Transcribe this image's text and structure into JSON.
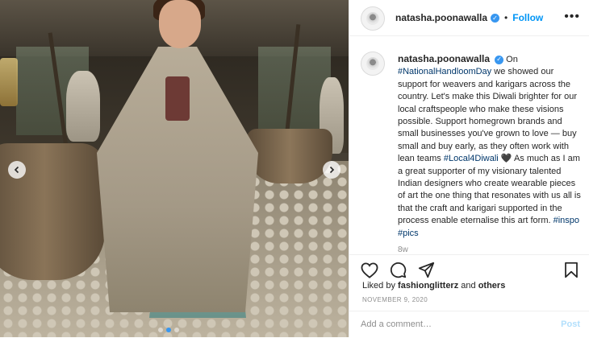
{
  "post": {
    "username": "natasha.poonawalla",
    "follow_label": "Follow",
    "more_label": "•••",
    "caption_username": "natasha.poonawalla",
    "caption_parts": {
      "p1": "On",
      "tag_national": "#NationalHandloomDay",
      "p2": "we showed our support for weavers and karigars across the country. Let's make this Diwali brighter for our local craftspeople who make these visions possible. Support homegrown brands and small businesses you've grown to love — buy small and buy early, as they often work with lean teams",
      "tag_local": "#Local4Diwali",
      "p3": "🖤 As much as I am a great supporter of my visionary talented Indian designers who create wearable pieces of art the one thing that resonates with us all is that the craft and karigari supported in the process enable eternalise this art form.",
      "tag_inspo": "#inspo",
      "tag_pics": "#pics"
    },
    "time_ago": "8w",
    "likes_prefix": "Liked by",
    "likes_user": "fashionglitterz",
    "likes_and": "and",
    "likes_others": "others",
    "date": "NOVEMBER 9, 2020",
    "comment_placeholder": "Add a comment…",
    "post_label": "Post"
  },
  "icons": {
    "like": "heart-icon",
    "comment": "comment-icon",
    "share": "share-icon",
    "save": "bookmark-icon",
    "verified": "verified-badge-icon",
    "prev": "chevron-left-icon",
    "next": "chevron-right-icon"
  },
  "colors": {
    "link": "#00376b",
    "follow": "#0095f6",
    "verified": "#3897f0",
    "muted": "#8e8e8e"
  }
}
